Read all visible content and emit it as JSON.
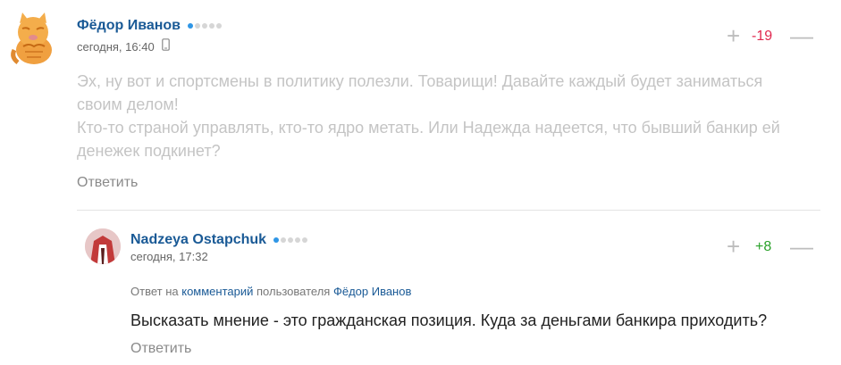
{
  "comment1": {
    "author": "Фёдор Иванов",
    "date": "сегодня, 16:40",
    "score": "-19",
    "text_line1": "Эх, ну вот и спортсмены в политику полезли. Товарищи! Давайте каждый будет заниматься",
    "text_line2": "своим делом!",
    "text_line3": "Кто-то страной управлять, кто-то ядро метать. Или Надежда надеется, что бывший банкир ей",
    "text_line4": "денежек подкинет?",
    "reply_label": "Ответить"
  },
  "comment2": {
    "author": "Nadzeya Ostapchuk",
    "date": "сегодня, 17:32",
    "score": "+8",
    "reply_to_prefix": "Ответ на",
    "reply_to_link": "комментарий",
    "reply_to_middle": "пользователя",
    "reply_to_user": "Фёдор Иванов",
    "text": "Высказать мнение - это гражданская позиция. Куда за деньгами банкира приходить?",
    "reply_label": "Ответить"
  },
  "vote": {
    "plus": "+",
    "minus": "—"
  },
  "colors": {
    "author": "#1a5a96",
    "negative": "#e0284f",
    "positive": "#2aa22a",
    "rating_dot": "#2f96e6"
  }
}
